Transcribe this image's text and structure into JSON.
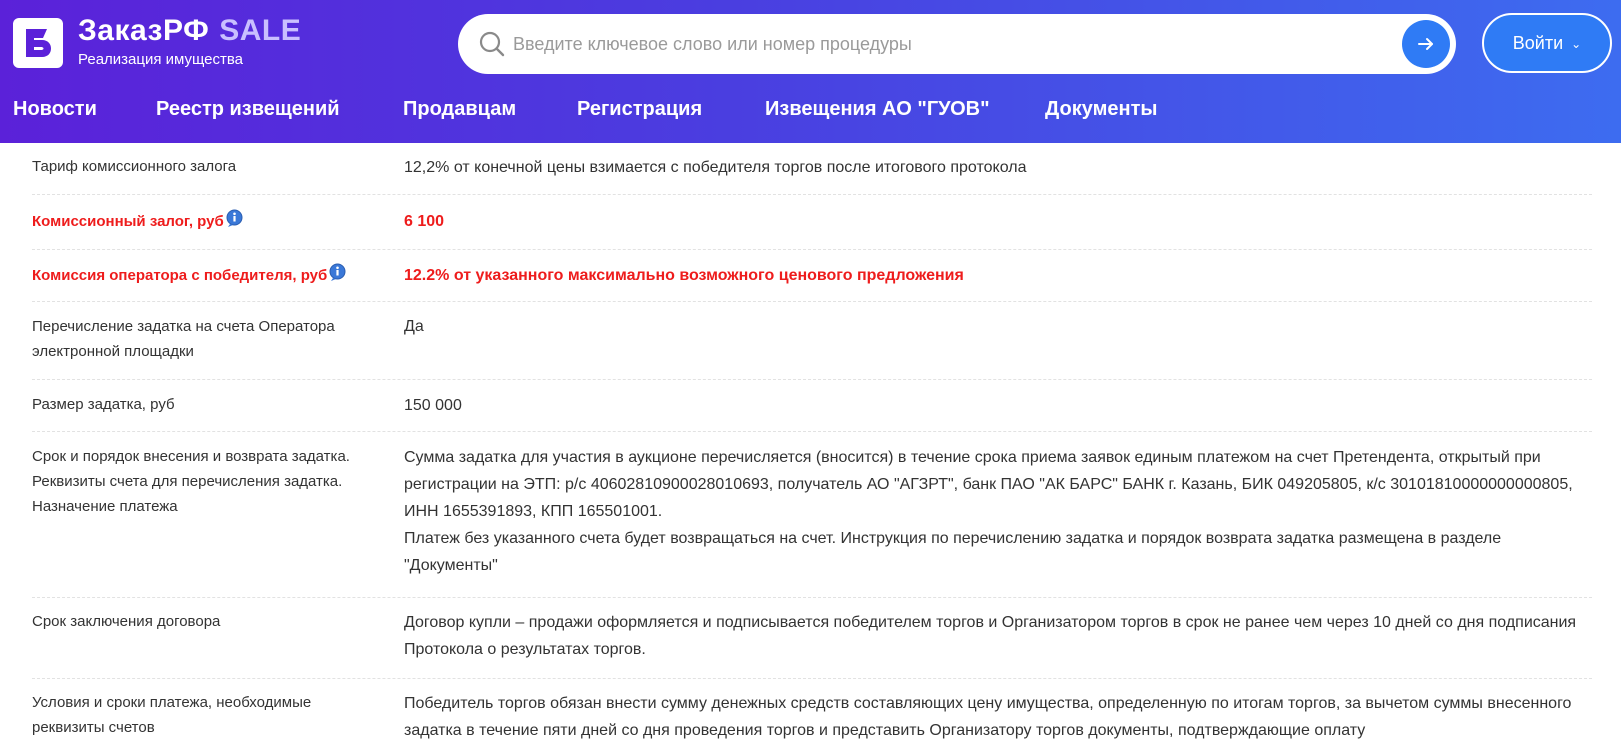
{
  "header": {
    "brand_name": "ЗаказРФ",
    "brand_sale": "SALE",
    "brand_subtitle": "Реализация имущества",
    "search_placeholder": "Введите ключевое слово или номер процедуры",
    "login_label": "Войти"
  },
  "nav": [
    {
      "label": "Новости"
    },
    {
      "label": "Реестр извещений"
    },
    {
      "label": "Продавцам"
    },
    {
      "label": "Регистрация"
    },
    {
      "label": "Извещения АО \"ГУОВ\""
    },
    {
      "label": "Документы"
    }
  ],
  "rows": [
    {
      "label": "Тариф комиссионного залога",
      "value": "12,2% от конечной цены взимается с победителя торгов после итогового протокола"
    },
    {
      "label": "Комиссионный залог, руб",
      "value": "6 100"
    },
    {
      "label": "Комиссия оператора с победителя, руб",
      "value": "12.2% от указанного максимально возможного ценового предложения"
    },
    {
      "label": "Перечисление задатка на счета Оператора электронной площадки",
      "value": "Да"
    },
    {
      "label": "Размер задатка, руб",
      "value": "150 000"
    },
    {
      "label": "Срок и порядок внесения и возврата задатка. Реквизиты счета для перечисления задатка. Назначение платежа",
      "value_p1": "Сумма задатка для участия в аукционе перечисляется (вносится) в течение срока приема заявок единым платежом на счет Претендента, открытый при регистрации на ЭТП: р/с 40602810900028010693, получатель АО \"АГЗРТ\", банк ПАО \"АК БАРС\" БАНК г. Казань, БИК 049205805, к/с 30101810000000000805, ИНН 1655391893, КПП 165501001.",
      "value_p2": "Платеж без указанного счета будет возвращаться на счет. Инструкция по перечислению задатка и порядок возврата задатка размещена в разделе \"Документы\""
    },
    {
      "label": "Срок заключения договора",
      "value": "Договор купли – продажи оформляется и подписывается победителем торгов и Организатором торгов в срок не ранее чем через 10 дней со дня подписания Протокола о результатах торгов."
    },
    {
      "label": "Условия и сроки платежа, необходимые реквизиты счетов",
      "value": "Победитель торгов обязан внести сумму денежных средств составляющих цену имущества, определенную по итогам торгов, за вычетом суммы внесенного задатка в течение пяти дней со дня проведения торгов и представить Организатору торгов документы, подтверждающие оплату"
    }
  ],
  "colors": {
    "header_gradient_start": "#5b21d9",
    "header_gradient_end": "#3d6cf0",
    "accent_blue": "#2f7bf5",
    "highlight_red": "#ee1c1c"
  },
  "icons": [
    "logo-icon",
    "search-icon",
    "arrow-right-icon",
    "chevron-down-icon",
    "info-icon"
  ]
}
